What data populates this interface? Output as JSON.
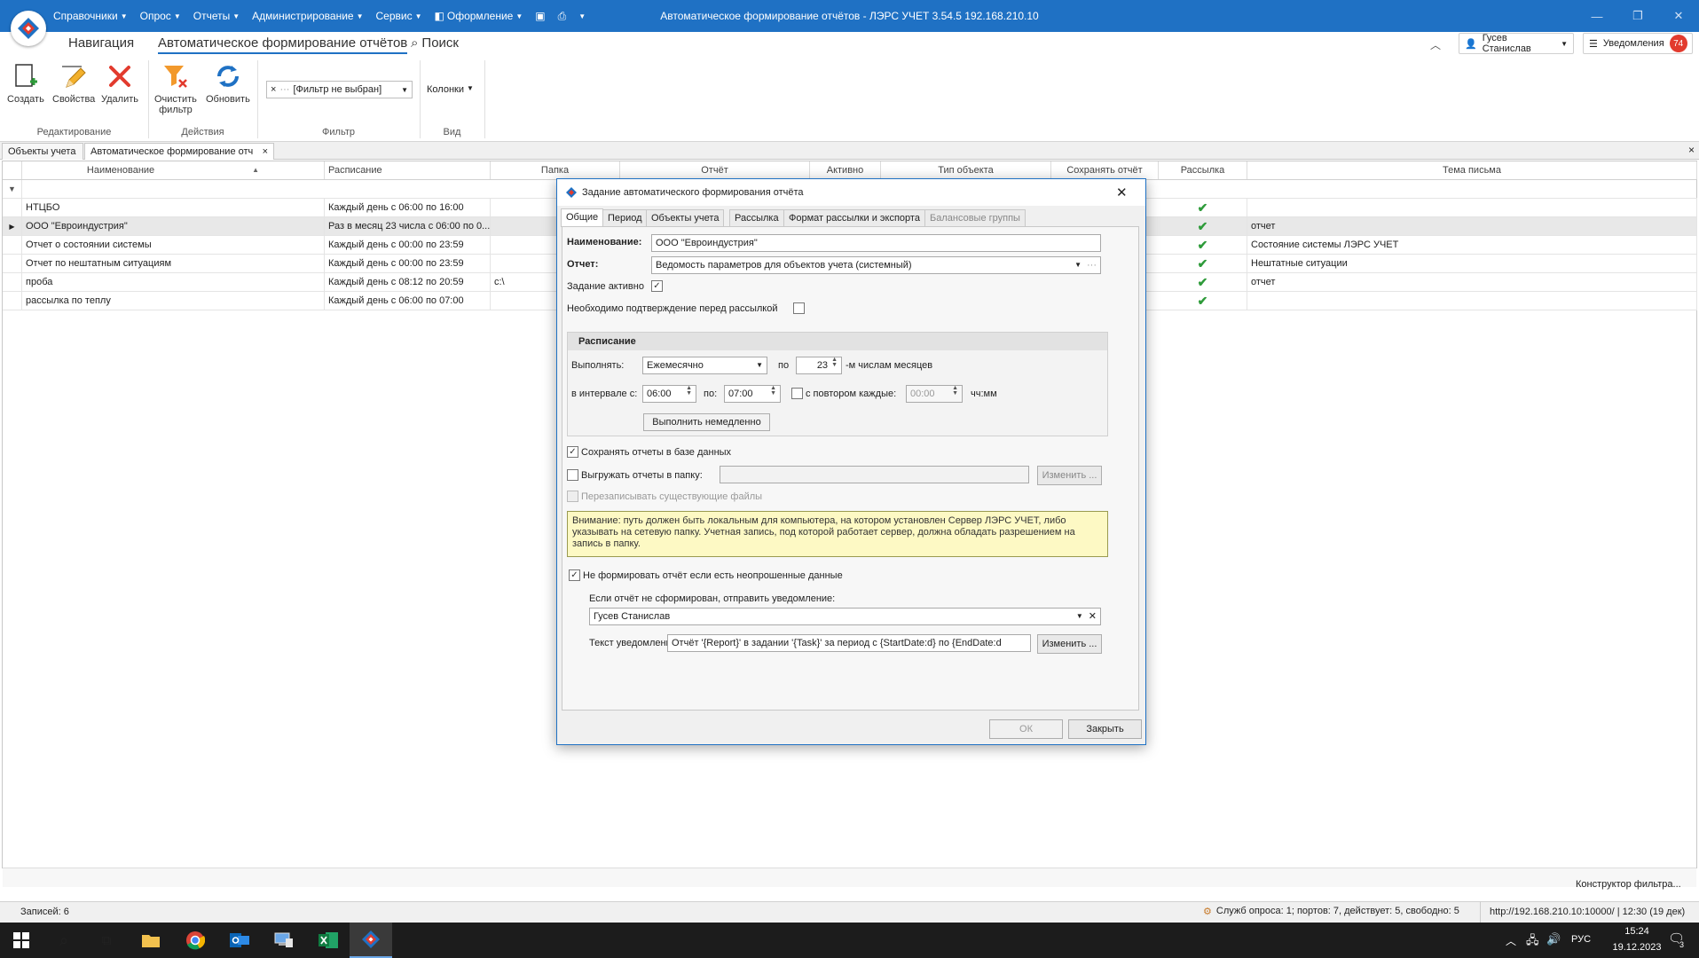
{
  "window": {
    "title": "Автоматическое формирование отчётов - ЛЭРС УЧЕТ 3.54.5 192.168.210.10",
    "menu": [
      "Справочники",
      "Опрос",
      "Отчеты",
      "Администрирование",
      "Сервис",
      "Оформление"
    ]
  },
  "ribbon": {
    "tabs": {
      "nav": "Навигация",
      "auto": "Автоматическое формирование отчётов",
      "search": "Поиск"
    },
    "buttons": {
      "create": "Создать",
      "props": "Свойства",
      "delete": "Удалить",
      "clear_filter_1": "Очистить",
      "clear_filter_2": "фильтр",
      "refresh": "Обновить",
      "columns": "Колонки"
    },
    "filter_value": "[Фильтр не выбран]",
    "groups": {
      "edit": "Редактирование",
      "actions": "Действия",
      "filter": "Фильтр",
      "view": "Вид"
    },
    "user": "Гусев Станислав",
    "notifications_label": "Уведомления",
    "notifications_count": "74"
  },
  "doc_tabs": [
    "Объекты учета",
    "Автоматическое формирование отч"
  ],
  "grid": {
    "columns": [
      "Наименование",
      "Расписание",
      "Папка",
      "Отчёт",
      "Активно",
      "Тип объекта",
      "Сохранять отчёт",
      "Рассылка",
      "Тема письма"
    ],
    "rows": [
      {
        "name": "НТЦБО",
        "schedule": "Каждый день с 06:00 по 16:00",
        "folder": "",
        "subject": ""
      },
      {
        "name": "ООО \"Евроиндустрия\"",
        "schedule": "Раз в месяц 23 числа с 06:00 по 0...",
        "folder": "",
        "subject": "отчет"
      },
      {
        "name": "Отчет о состоянии системы",
        "schedule": "Каждый день с 00:00 по 23:59",
        "folder": "",
        "subject": "Состояние системы ЛЭРС УЧЕТ"
      },
      {
        "name": "Отчет по нештатным ситуациям",
        "schedule": "Каждый день с 00:00 по 23:59",
        "folder": "",
        "subject": "Нештатные ситуации"
      },
      {
        "name": "проба",
        "schedule": "Каждый день с 08:12 по 20:59",
        "folder": "c:\\",
        "subject": "отчет"
      },
      {
        "name": "рассылка по теплу",
        "schedule": "Каждый день с 06:00 по 07:00",
        "folder": "",
        "subject": ""
      }
    ],
    "filter_builder": "Конструктор фильтра..."
  },
  "dialog": {
    "title": "Задание автоматического формирования отчёта",
    "tabs": [
      "Общие",
      "Период",
      "Объекты учета",
      "Рассылка",
      "Формат рассылки и экспорта",
      "Балансовые группы"
    ],
    "name_label": "Наименование:",
    "name_value": "ООО \"Евроиндустрия\"",
    "report_label": "Отчет:",
    "report_value": "Ведомость параметров для объектов учета (системный)",
    "active_label": "Задание активно",
    "confirm_label": "Необходимо подтверждение перед рассылкой",
    "schedule": {
      "header": "Расписание",
      "run_label": "Выполнять:",
      "run_value": "Ежемесячно",
      "on_label": "по",
      "day_value": "23",
      "day_suffix": "-м числам месяцев",
      "interval_label": "в интервале с:",
      "from_value": "06:00",
      "to_label": "по:",
      "to_value": "07:00",
      "repeat_label": "с повтором каждые:",
      "repeat_value": "00:00",
      "repeat_unit": "чч:мм",
      "run_now": "Выполнить немедленно"
    },
    "save_db_label": "Сохранять отчеты в базе данных",
    "export_folder_label": "Выгружать отчеты в папку:",
    "change_btn": "Изменить ...",
    "overwrite_label": "Перезаписывать существующие файлы",
    "warning": "Внимание: путь должен быть локальным для компьютера, на котором установлен Сервер ЛЭРС УЧЕТ, либо указывать на сетевую папку. Учетная запись, под которой работает сервер, должна обладать разрешением на запись в папку.",
    "no_form_label": "Не формировать отчёт если есть неопрошенные данные",
    "notify_label": "Если отчёт не сформирован, отправить уведомление:",
    "notify_user": "Гусев Станислав",
    "notify_text_label": "Текст уведомления:",
    "notify_text_value": "Отчёт '{Report}' в задании '{Task}' за период с {StartDate:d} по {EndDate:d",
    "ok": "ОК",
    "close": "Закрыть"
  },
  "status": {
    "records": "Записей: 6",
    "services": "Служб опроса: 1; портов: 7, действует: 5, свободно: 5",
    "server": "http://192.168.210.10:10000/ | 12:30 (19 дек)"
  },
  "taskbar": {
    "lang": "РУС",
    "time": "15:24",
    "date": "19.12.2023",
    "notif_count": "3"
  },
  "colors": {
    "accent": "#1f71c4",
    "check": "#2e9b3a",
    "badge": "#e23b2e"
  }
}
